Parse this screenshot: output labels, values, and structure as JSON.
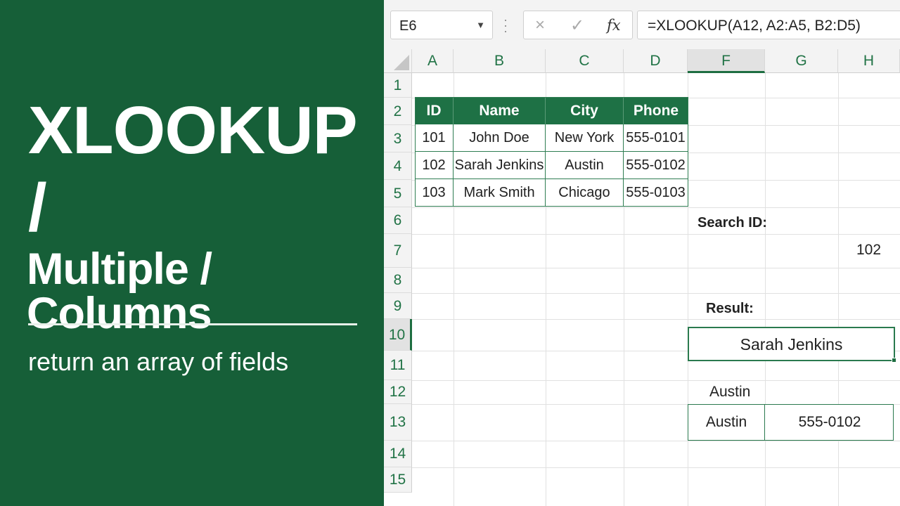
{
  "left_panel": {
    "title_line_1": "XLOOKUP",
    "title_line_2": "/",
    "title_line_3": "Multiple / Columns",
    "subtitle": "return an array of fields",
    "background_color": "#165f38"
  },
  "formula_bar": {
    "name_box": "E6",
    "cancel_icon": "×",
    "enter_icon": "✓",
    "fx_label": "fx",
    "formula": "=XLOOKUP(A12, A2:A5, B2:D5)"
  },
  "columns": [
    "A",
    "B",
    "C",
    "D",
    "F",
    "G",
    "H"
  ],
  "selected_column": "F",
  "rows": [
    "1",
    "2",
    "3",
    "4",
    "5",
    "6",
    "7",
    "8",
    "9",
    "10",
    "11",
    "12",
    "13",
    "14",
    "15"
  ],
  "selected_row": "10",
  "table": {
    "headers": [
      "ID",
      "Name",
      "City",
      "Phone"
    ],
    "rows": [
      [
        "101",
        "John Doe",
        "New York",
        "555-0101"
      ],
      [
        "102",
        "Sarah Jenkins",
        "Austin",
        "555-0102"
      ],
      [
        "103",
        "Mark Smith",
        "Chicago",
        "555-0103"
      ]
    ]
  },
  "lookup": {
    "search_label": "Search ID:",
    "search_value": "102",
    "result_label": "Result:",
    "result_value": "Sarah Jenkins",
    "row12_label": "Austin",
    "spill_city": "Austin",
    "spill_phone": "555-0102"
  },
  "colors": {
    "accent": "#1e7145",
    "header_text": "#217346"
  }
}
